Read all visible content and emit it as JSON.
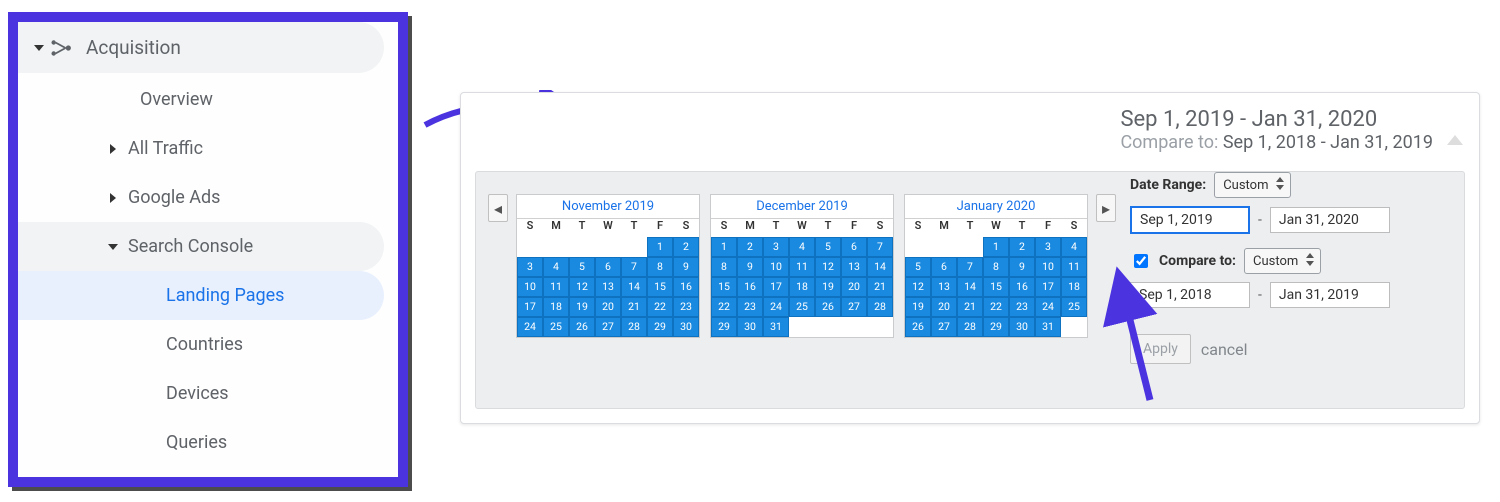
{
  "sidebar": {
    "section_title": "Acquisition",
    "items": [
      {
        "label": "Overview"
      },
      {
        "label": "All Traffic",
        "has_children": true
      },
      {
        "label": "Google Ads",
        "has_children": true
      },
      {
        "label": "Search Console",
        "has_children": true,
        "expanded": true,
        "children": [
          {
            "label": "Landing Pages",
            "active": true
          },
          {
            "label": "Countries"
          },
          {
            "label": "Devices"
          },
          {
            "label": "Queries"
          }
        ]
      }
    ]
  },
  "date_panel": {
    "primary_range": "Sep 1, 2019 - Jan 31, 2020",
    "compare_prefix": "Compare to:",
    "compare_range": "Sep 1, 2018 - Jan 31, 2019",
    "date_range_label": "Date Range:",
    "date_range_select": "Custom",
    "start_input": "Sep 1, 2019",
    "end_input": "Jan 31, 2020",
    "compare_checkbox_label": "Compare to:",
    "compare_checked": true,
    "compare_select": "Custom",
    "compare_start_input": "Sep 1, 2018",
    "compare_end_input": "Jan 31, 2019",
    "apply_label": "Apply",
    "cancel_label": "cancel",
    "months": [
      {
        "title": "November 2019",
        "leading_blanks": 5,
        "days": 30,
        "sel_from": 1,
        "sel_to": 30
      },
      {
        "title": "December 2019",
        "leading_blanks": 0,
        "days": 31,
        "sel_from": 1,
        "sel_to": 31
      },
      {
        "title": "January 2020",
        "leading_blanks": 3,
        "days": 31,
        "sel_from": 1,
        "sel_to": 31
      }
    ],
    "dow": [
      "S",
      "M",
      "T",
      "W",
      "T",
      "F",
      "S"
    ]
  }
}
